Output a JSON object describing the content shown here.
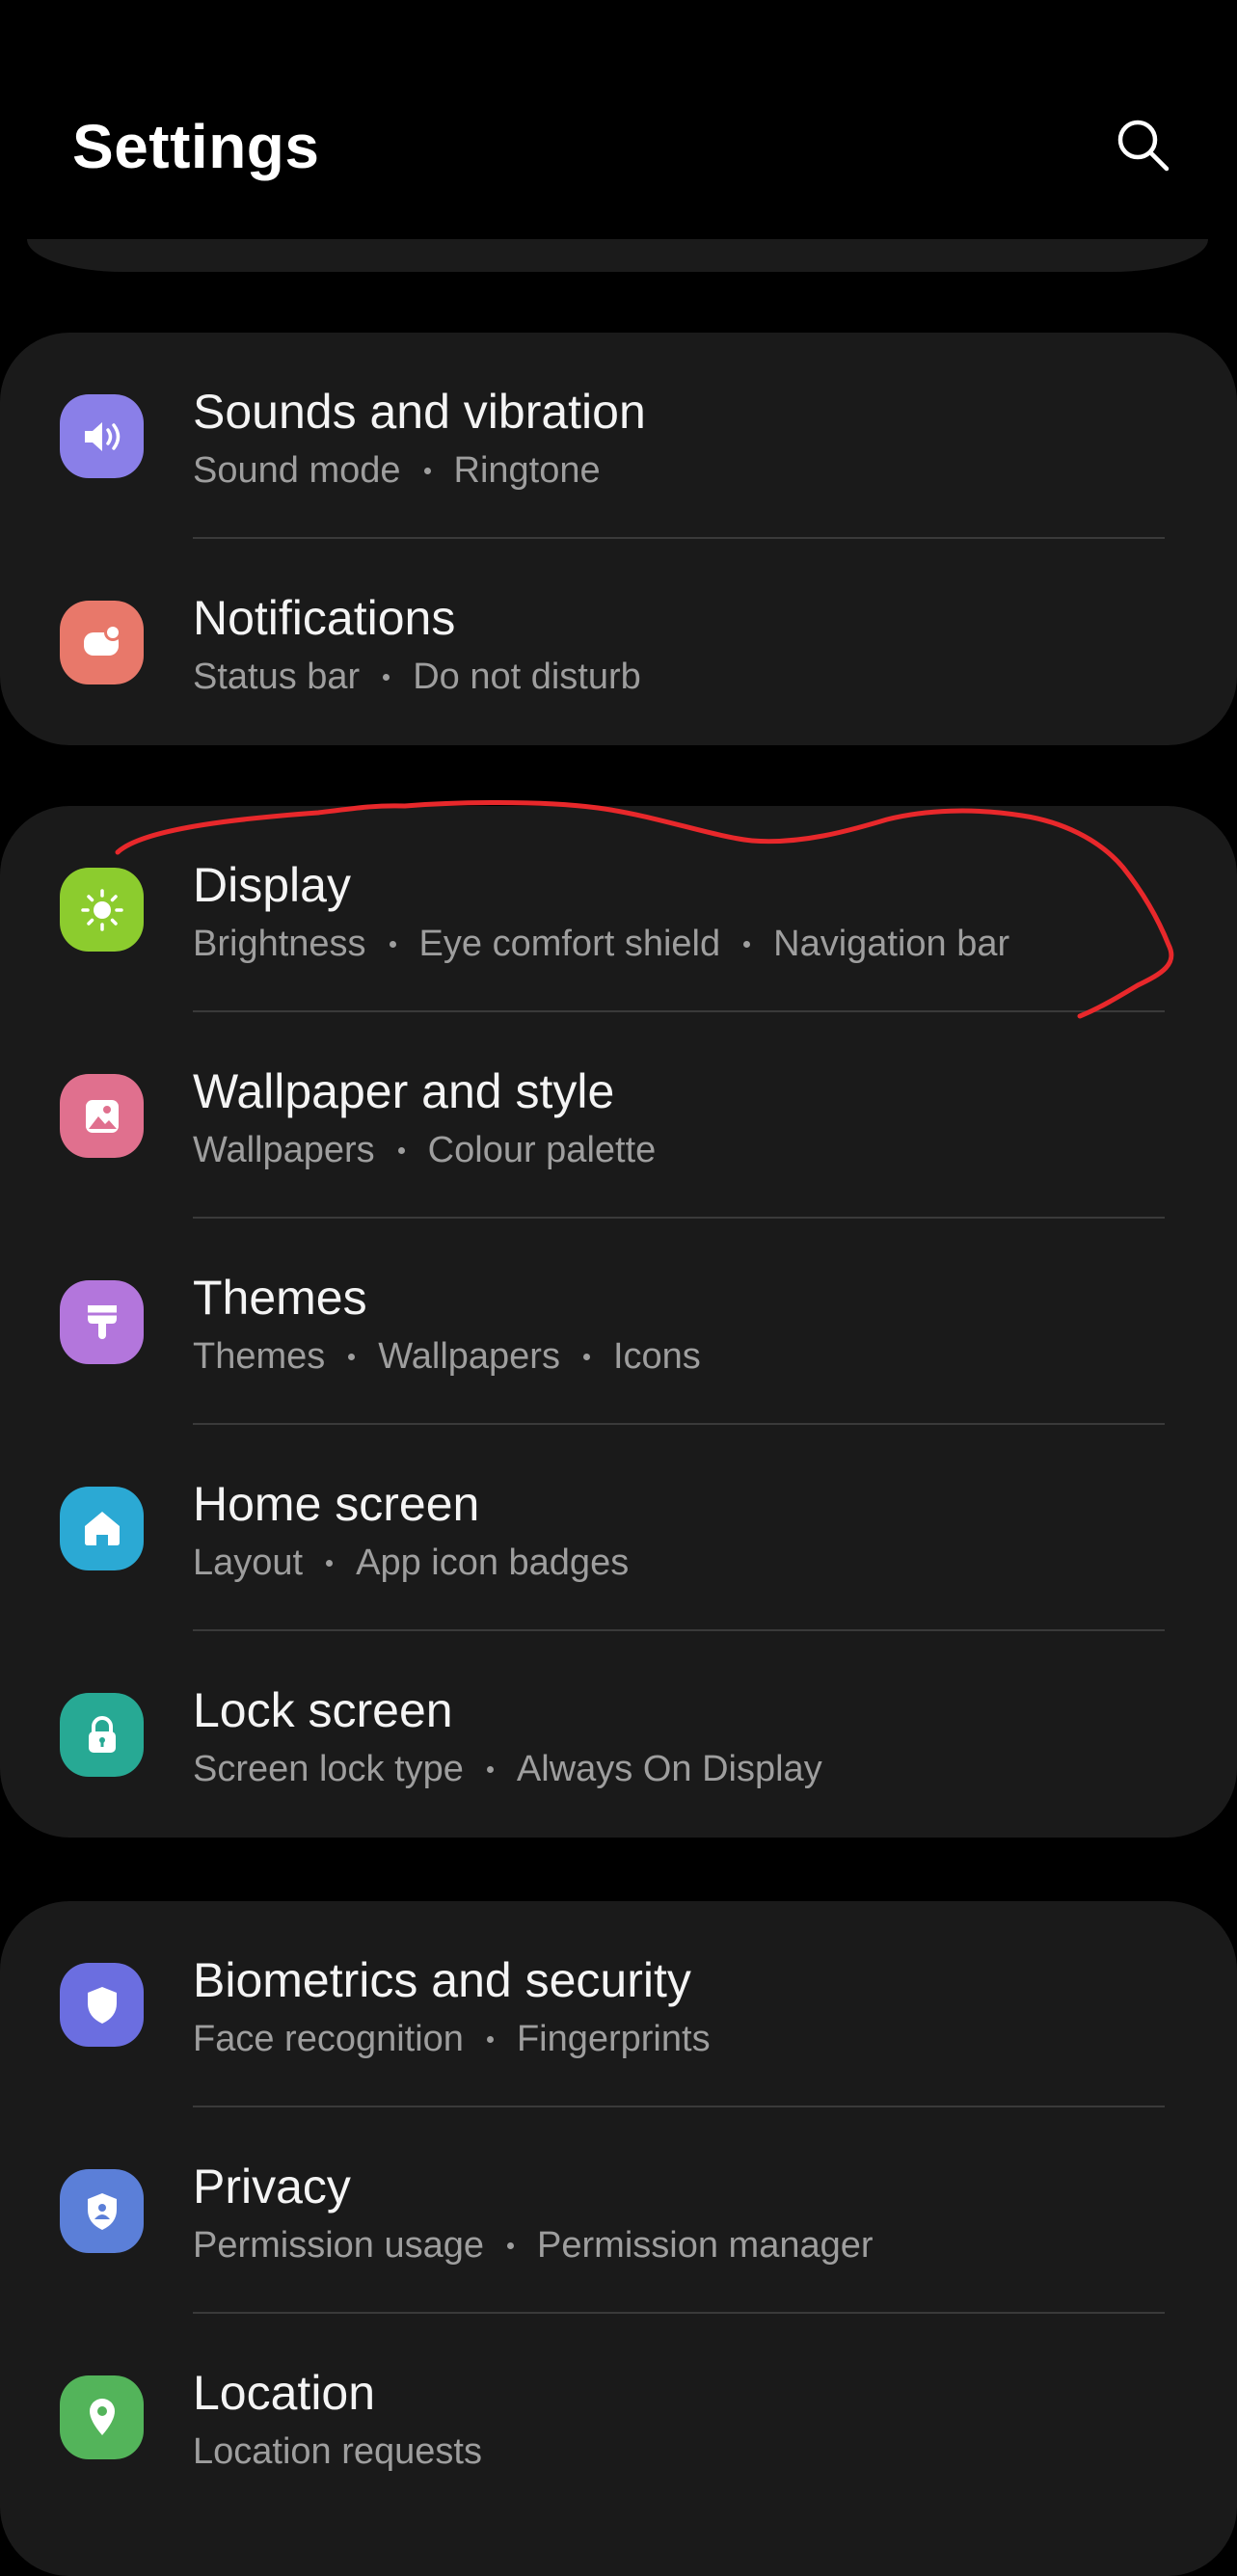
{
  "header": {
    "title": "Settings",
    "search_icon": "search-icon"
  },
  "groups": [
    {
      "items": [
        {
          "title": "Sounds and vibration",
          "subtitles": [
            "Sound mode",
            "Ringtone"
          ],
          "icon": "volume-icon",
          "color": "#8a7fe8"
        },
        {
          "title": "Notifications",
          "subtitles": [
            "Status bar",
            "Do not disturb"
          ],
          "icon": "notification-icon",
          "color": "#e8786a"
        }
      ]
    },
    {
      "items": [
        {
          "title": "Display",
          "subtitles": [
            "Brightness",
            "Eye comfort shield",
            "Navigation bar"
          ],
          "icon": "sun-icon",
          "color": "#8ccc2e"
        },
        {
          "title": "Wallpaper and style",
          "subtitles": [
            "Wallpapers",
            "Colour palette"
          ],
          "icon": "image-icon",
          "color": "#e0708e"
        },
        {
          "title": "Themes",
          "subtitles": [
            "Themes",
            "Wallpapers",
            "Icons"
          ],
          "icon": "paintbrush-icon",
          "color": "#b376dc"
        },
        {
          "title": "Home screen",
          "subtitles": [
            "Layout",
            "App icon badges"
          ],
          "icon": "home-icon",
          "color": "#2ba9d4"
        },
        {
          "title": "Lock screen",
          "subtitles": [
            "Screen lock type",
            "Always On Display"
          ],
          "icon": "lock-icon",
          "color": "#27a994"
        }
      ]
    },
    {
      "items": [
        {
          "title": "Biometrics and security",
          "subtitles": [
            "Face recognition",
            "Fingerprints"
          ],
          "icon": "shield-icon",
          "color": "#6b6ee0"
        },
        {
          "title": "Privacy",
          "subtitles": [
            "Permission usage",
            "Permission manager"
          ],
          "icon": "privacy-shield-icon",
          "color": "#5b7fd8"
        },
        {
          "title": "Location",
          "subtitles": [
            "Location requests"
          ],
          "icon": "location-pin-icon",
          "color": "#53b45a"
        }
      ]
    }
  ],
  "annotation": {
    "color": "#e8282b",
    "target": "Display"
  }
}
